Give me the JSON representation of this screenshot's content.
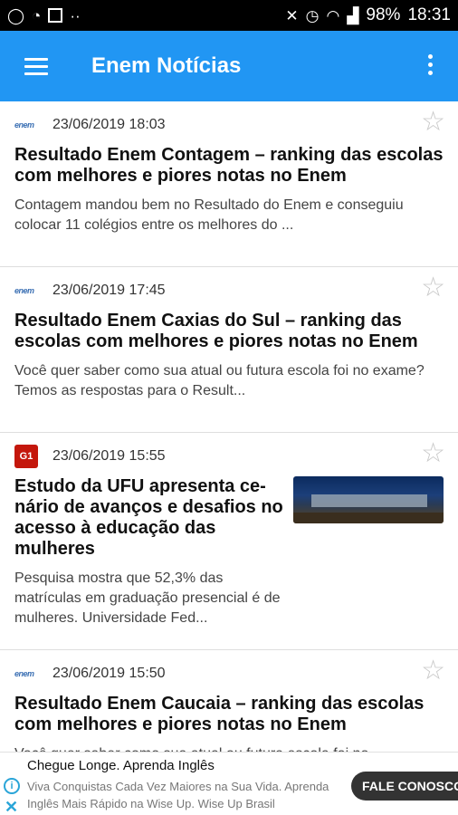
{
  "status_bar": {
    "left_icons": [
      "whatsapp-icon",
      "rss-icon",
      "flipboard-icon",
      "more-notifications-icon"
    ],
    "right_icons": [
      "mute-icon",
      "alarm-icon",
      "wifi-icon",
      "signal-icon"
    ],
    "battery": "98%",
    "time": "18:31"
  },
  "app_bar": {
    "title": "Enem Notícias",
    "accent_color": "#2196f3"
  },
  "articles": [
    {
      "source_icon": "enem-logo",
      "source_text": "enem",
      "date": "23/06/2019 18:03",
      "title": "Resultado Enem Contagem – ranking das escolas com melhores e piores notas no Enem",
      "description": "Contagem mandou bem no Resultado do Enem e conseguiu colocar 11 colégios entre os melhores do ..."
    },
    {
      "source_icon": "enem-logo",
      "source_text": "enem",
      "date": "23/06/2019 17:45",
      "title": "Resultado Enem Caxias do Sul – ranking das escolas com melhores e piores notas no Enem",
      "description": "Você quer saber como sua atual ou futura escola foi no exame? Temos as respostas para o Result..."
    },
    {
      "source_icon": "g1-logo",
      "source_text": "G1",
      "date": "23/06/2019 15:55",
      "title": "Estudo da UFU apresenta ce-nário de avanços e desafios no acesso à educação das mulheres",
      "description": "Pesquisa mostra que 52,3% das matrículas em graduação presencial é de mulheres. Universidade Fed..."
    },
    {
      "source_icon": "enem-logo",
      "source_text": "enem",
      "date": "23/06/2019 15:50",
      "title": "Resultado Enem Caucaia – ranking das escolas com melhores e piores notas no Enem",
      "description": "Você quer saber como sua atual ou futura escola foi no"
    }
  ],
  "ad": {
    "title": "Chegue Longe. Aprenda Inglês",
    "body": "Viva Conquistas Cada Vez Maiores na Sua Vida. Aprenda Inglês Mais Rápido na Wise Up. Wise Up Brasil",
    "button": "FALE CONOSCO",
    "info_icon": "i",
    "close_icon": "✕"
  }
}
